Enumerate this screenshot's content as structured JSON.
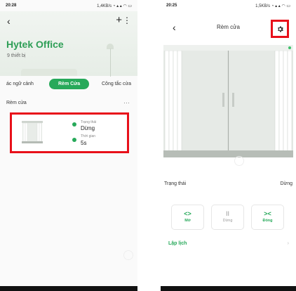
{
  "left": {
    "status": {
      "time": "20:28",
      "right": "1,4KB/s"
    },
    "home": {
      "title": "Hytek Office",
      "subtitle": "9 thiết bị"
    },
    "tabs": [
      "ác ngữ cảnh",
      "Rèm Cửa",
      "Công tắc cửa"
    ],
    "section": {
      "title": "Rèm cửa",
      "more": "···"
    },
    "card": {
      "state_label": "Trạng thái",
      "state_value": "Dừng",
      "time_label": "Thời gian",
      "time_value": "5s"
    }
  },
  "right": {
    "status": {
      "time": "20:25",
      "right": "1,5KB/s"
    },
    "title": "Rèm cửa",
    "status_row": {
      "label": "Trạng thái",
      "value": "Dừng"
    },
    "controls": [
      {
        "icon": "<>",
        "label": "Mở"
      },
      {
        "icon": "II",
        "label": "Dừng"
      },
      {
        "icon": "><",
        "label": "Đóng"
      }
    ],
    "schedule": {
      "label": "Lập lịch",
      "chevron": "›"
    }
  },
  "colors": {
    "accent": "#27a95a",
    "highlight": "#e8101a"
  }
}
